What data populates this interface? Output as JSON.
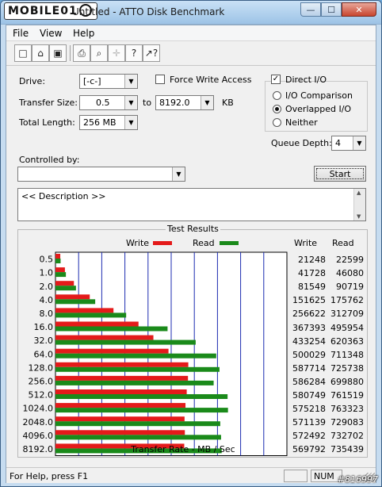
{
  "window": {
    "title": "Untitled - ATTO Disk Benchmark",
    "logo_text": "MOBILE01",
    "min_glyph": "—",
    "max_glyph": "☐",
    "close_glyph": "✕"
  },
  "menu": {
    "file": "File",
    "view": "View",
    "help": "Help"
  },
  "toolbar": {
    "new": "□",
    "open": "⌂",
    "save": "▣",
    "print": "⎙",
    "preview": "⌕",
    "move": "✛",
    "help": "?",
    "context_help": "↗?"
  },
  "form": {
    "drive_label": "Drive:",
    "drive_value": "[-c-]",
    "force_write_label": "Force Write Access",
    "direct_io_label": "Direct I/O",
    "transfer_size_label": "Transfer Size:",
    "transfer_from": "0.5",
    "to_label": "to",
    "transfer_to": "8192.0",
    "kb_label": "KB",
    "total_length_label": "Total Length:",
    "total_length_value": "256 MB",
    "io_comparison_label": "I/O Comparison",
    "overlapped_io_label": "Overlapped I/O",
    "neither_label": "Neither",
    "queue_depth_label": "Queue Depth:",
    "queue_depth_value": "4",
    "controlled_by_label": "Controlled by:",
    "controlled_by_value": "",
    "start_label": "Start",
    "description_text": "<< Description >>",
    "check_glyph": "✓",
    "arrow_glyph": "▼"
  },
  "chart_data": {
    "type": "bar",
    "title": "Test Results",
    "xlabel": "Transfer Rate - MB / Sec",
    "xlim": [
      0,
      1000
    ],
    "xticks": [
      0,
      100,
      200,
      300,
      400,
      500,
      600,
      700,
      800,
      900,
      1000
    ],
    "categories": [
      "0.5",
      "1.0",
      "2.0",
      "4.0",
      "8.0",
      "16.0",
      "32.0",
      "64.0",
      "128.0",
      "256.0",
      "512.0",
      "1024.0",
      "2048.0",
      "4096.0",
      "8192.0"
    ],
    "series": [
      {
        "name": "Write",
        "color": "#e41a1a",
        "values": [
          21248,
          41728,
          81549,
          151625,
          256622,
          367393,
          433254,
          500029,
          587714,
          586284,
          580749,
          575218,
          571139,
          572492,
          569792
        ]
      },
      {
        "name": "Read",
        "color": "#1a8a1a",
        "values": [
          22599,
          46080,
          90719,
          175762,
          312709,
          495954,
          620363,
          711348,
          725738,
          699880,
          761519,
          763323,
          729083,
          732702,
          735439
        ]
      }
    ],
    "column_headers": {
      "write": "Write",
      "read": "Read"
    },
    "grid": true,
    "legend": "top"
  },
  "status": {
    "help_text": "For Help, press F1",
    "num": "NUM"
  },
  "watermark": "#816997"
}
